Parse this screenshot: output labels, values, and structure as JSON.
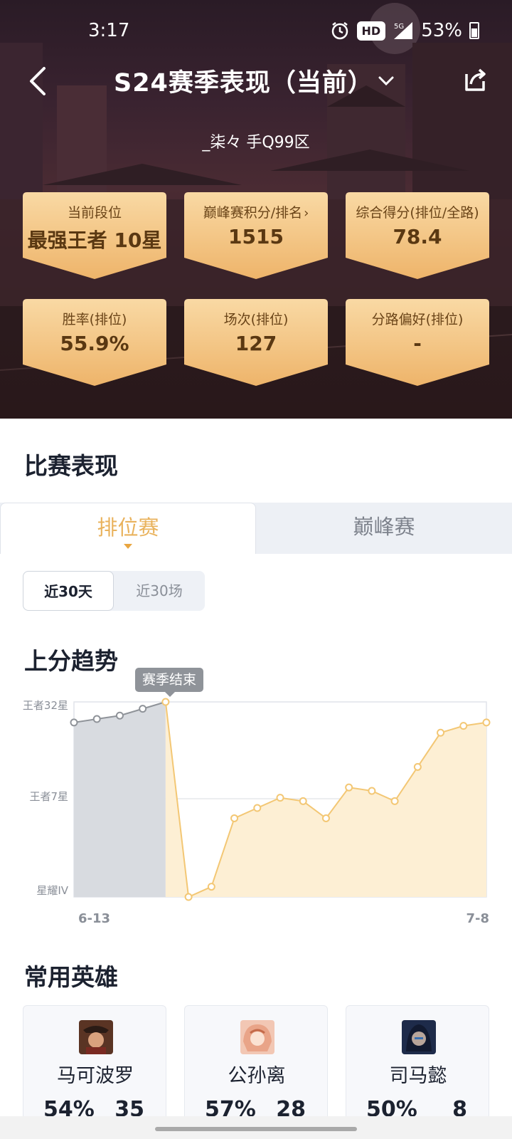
{
  "status_bar": {
    "time": "3:17",
    "hd": "HD",
    "network": "5G",
    "battery": "53%"
  },
  "header": {
    "title": "S24赛季表现（当前）",
    "player": "_柒々  手Q99区"
  },
  "stats": [
    {
      "label": "当前段位",
      "value": "最强王者 10星"
    },
    {
      "label": "巅峰赛积分/排名",
      "value": "1515",
      "arrow": "›"
    },
    {
      "label": "综合得分(排位/全路)",
      "value": "78.4"
    },
    {
      "label": "胜率(排位)",
      "value": "55.9%"
    },
    {
      "label": "场次(排位)",
      "value": "127"
    },
    {
      "label": "分路偏好(排位)",
      "value": "-"
    }
  ],
  "performance": {
    "title": "比赛表现",
    "tabs": [
      "排位赛",
      "巅峰赛"
    ],
    "ranges": [
      "近30天",
      "近30场"
    ]
  },
  "trend": {
    "title": "上分趋势",
    "tooltip": "赛季结束"
  },
  "chart_data": {
    "type": "line",
    "y_tick_labels": [
      "王者32星",
      "王者7星",
      "星耀IV"
    ],
    "x_tick_labels": [
      "6-13",
      "7-8"
    ],
    "grid": true,
    "values": [
      29,
      30,
      31,
      33,
      35,
      -22,
      -19,
      1,
      4,
      7,
      6,
      1,
      10,
      9,
      6,
      16,
      26,
      28,
      29
    ],
    "season_end_index": 4,
    "ylim": [
      -22,
      35
    ],
    "colors": {
      "past": "#d8dbe0",
      "current": "#f3c774",
      "fill": "#fdefd4",
      "past_line": "#8f9399"
    }
  },
  "heroes": {
    "title": "常用英雄",
    "items": [
      {
        "name": "马可波罗",
        "rate": "54%",
        "games": "35"
      },
      {
        "name": "公孙离",
        "rate": "57%",
        "games": "28"
      },
      {
        "name": "司马懿",
        "rate": "50%",
        "games": "8"
      }
    ]
  }
}
